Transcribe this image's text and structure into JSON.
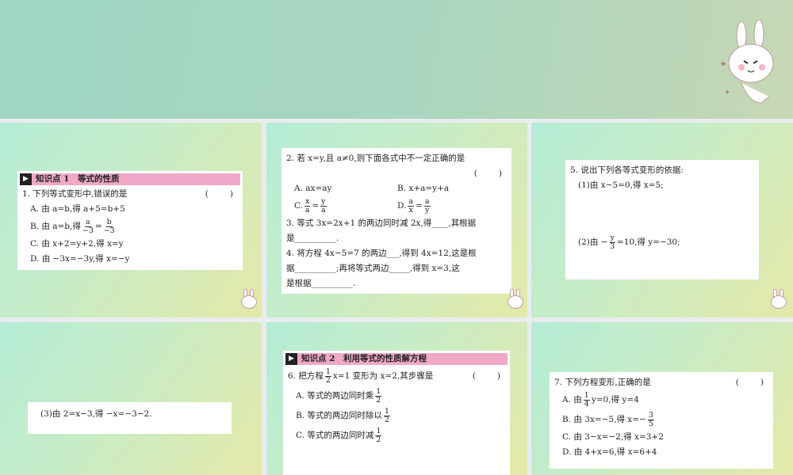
{
  "slides": [
    {
      "id": "s1",
      "header": "知识点 1　等式的性质",
      "lines": [
        {
          "segs": [
            "1. 下列等式变形中,错误的是",
            {
              "r": "(　　)"
            }
          ]
        },
        {
          "ind": true,
          "segs": [
            "A. 由 a=b,得 a+5=b+5"
          ]
        },
        {
          "ind": true,
          "tall": true,
          "segs": [
            "B. 由 a=b,得",
            {
              "f": [
                "a",
                "−3"
              ]
            },
            "=",
            {
              "f": [
                "b",
                "−3"
              ]
            }
          ]
        },
        {
          "ind": true,
          "segs": [
            "C. 由 x+2=y+2,得 x=y"
          ]
        },
        {
          "ind": true,
          "segs": [
            "D. 由 −3x=−3y,得 x=−y"
          ]
        }
      ]
    },
    {
      "id": "s2",
      "lines": [
        {
          "segs": [
            "2. 若 x=y,且 a≠0,则下面各式中不一定正确的是"
          ]
        },
        {
          "segs": [
            {
              "r": "(　　)"
            }
          ]
        },
        {
          "ind": true,
          "segs": [
            "A. ax=ay",
            {
              "c": "B. x+a=y+a"
            }
          ]
        },
        {
          "ind": true,
          "tall": true,
          "segs": [
            "C.",
            {
              "f": [
                "x",
                "a"
              ]
            },
            "=",
            {
              "f": [
                "y",
                "a"
              ]
            },
            {
              "c2": [
                "D.",
                [
                  "a",
                  "x"
                ],
                [
                  "a",
                  "y"
                ]
              ]
            }
          ]
        },
        {
          "segs": [
            "3. 等式 3x=2x+1 的两边同时减 2x,得____,其根据"
          ]
        },
        {
          "segs": [
            "是__________."
          ]
        },
        {
          "segs": [
            "4. 将方程 4x−5=7 的两边___,得到 4x=12,这是根"
          ]
        },
        {
          "segs": [
            "据__________;再将等式两边_____,得到 x=3,这"
          ]
        },
        {
          "segs": [
            "是根据__________."
          ]
        }
      ]
    },
    {
      "id": "s3",
      "lines": [
        {
          "segs": [
            "5. 说出下列各等式变形的依据:"
          ]
        },
        {
          "ind": true,
          "segs": [
            "(1)由 x−5=0,得 x=5;"
          ]
        },
        {
          "gap": true
        },
        {
          "ind": true,
          "tall": true,
          "segs": [
            "(2)由 −",
            {
              "f": [
                "y",
                "3"
              ]
            },
            "=10,得 y=−30;"
          ]
        }
      ]
    },
    {
      "id": "s4",
      "lines": [
        {
          "ind": true,
          "segs": [
            "(3)由 2=x−3,得 −x=−3−2."
          ]
        }
      ]
    },
    {
      "id": "s5",
      "header": "知识点 2　利用等式的性质解方程",
      "lines": [
        {
          "tall": true,
          "segs": [
            "6. 把方程",
            {
              "f": [
                "1",
                "2"
              ]
            },
            "x=1 变形为 x=2,其步骤是",
            {
              "r": "(　　)"
            }
          ]
        },
        {
          "ind": true,
          "tall": true,
          "segs": [
            "A. 等式的两边同时乘",
            {
              "f": [
                "1",
                "2"
              ]
            }
          ]
        },
        {
          "ind": true,
          "tall": true,
          "segs": [
            "B. 等式的两边同时除以",
            {
              "f": [
                "1",
                "2"
              ]
            }
          ]
        },
        {
          "ind": true,
          "tall": true,
          "segs": [
            "C. 等式的两边同时减",
            {
              "f": [
                "1",
                "2"
              ]
            }
          ]
        }
      ]
    },
    {
      "id": "s6",
      "lines": [
        {
          "segs": [
            "7. 下列方程变形,正确的是",
            {
              "r": "(　　)"
            }
          ]
        },
        {
          "ind": true,
          "tall": true,
          "segs": [
            "A. 由",
            {
              "f": [
                "1",
                "4"
              ]
            },
            "y=0,得 y=4"
          ]
        },
        {
          "ind": true,
          "tall": true,
          "segs": [
            "B. 由 3x=−5,得 x=−",
            {
              "f": [
                "3",
                "5"
              ]
            }
          ]
        },
        {
          "ind": true,
          "segs": [
            "C. 由 3−x=−2,得 x=3+2"
          ]
        },
        {
          "ind": true,
          "segs": [
            "D. 由 4+x=6,得 x=6+4"
          ]
        }
      ]
    }
  ]
}
